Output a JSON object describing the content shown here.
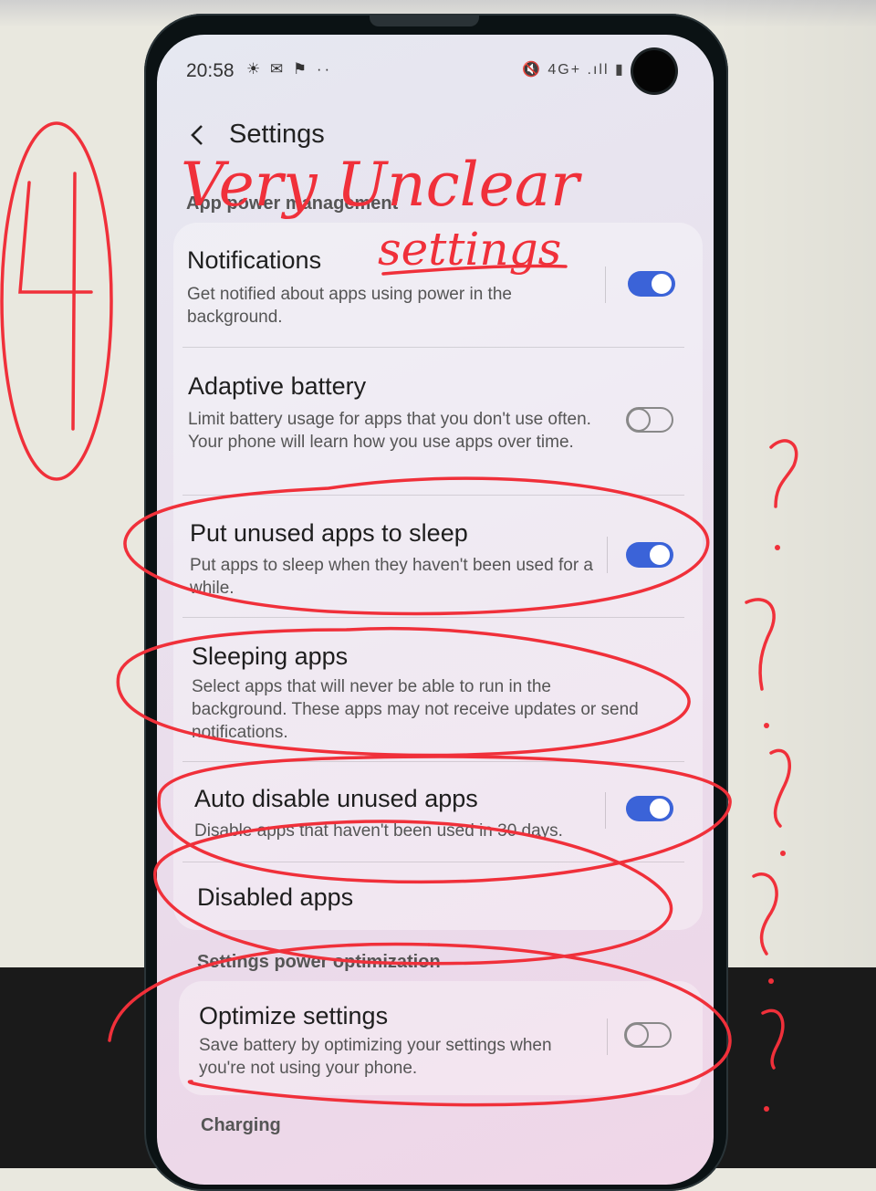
{
  "status_bar": {
    "time": "20:58",
    "left_icons": "☀ ✉ ⚑ ··",
    "right_icons": "🔇 4G+ .ıll ▮"
  },
  "header": {
    "title": "Settings",
    "back_icon": "chevron-left-icon"
  },
  "sections": {
    "app_power": {
      "label": "App power management"
    },
    "settings_power": {
      "label": "Settings power optimization"
    },
    "charging": {
      "label": "Charging"
    }
  },
  "items": {
    "notifications": {
      "title": "Notifications",
      "subtitle": "Get notified about apps using power in the background.",
      "toggle": true
    },
    "adaptive_battery": {
      "title": "Adaptive battery",
      "subtitle": "Limit battery usage for apps that you don't use often. Your phone will learn how you use apps over time.",
      "toggle": false
    },
    "put_unused_to_sleep": {
      "title": "Put unused apps to sleep",
      "subtitle": "Put apps to sleep when they haven't been used for a while.",
      "toggle": true
    },
    "sleeping_apps": {
      "title": "Sleeping apps",
      "subtitle": "Select apps that will never be able to run in the background. These apps may not receive updates or send notifications."
    },
    "auto_disable": {
      "title": "Auto disable unused apps",
      "subtitle": "Disable apps that haven't been used in 30 days.",
      "toggle": true
    },
    "disabled_apps": {
      "title": "Disabled apps"
    },
    "optimize_settings": {
      "title": "Optimize settings",
      "subtitle": "Save battery by optimizing your settings when you're not using your phone.",
      "toggle": false
    }
  },
  "annotations": {
    "number": "4",
    "headline_line1": "Very Unclear",
    "headline_line2": "settings",
    "marks": "?",
    "color": "#f0303a"
  },
  "colors": {
    "toggle_on": "#3b63d8",
    "toggle_off": "#888888"
  }
}
